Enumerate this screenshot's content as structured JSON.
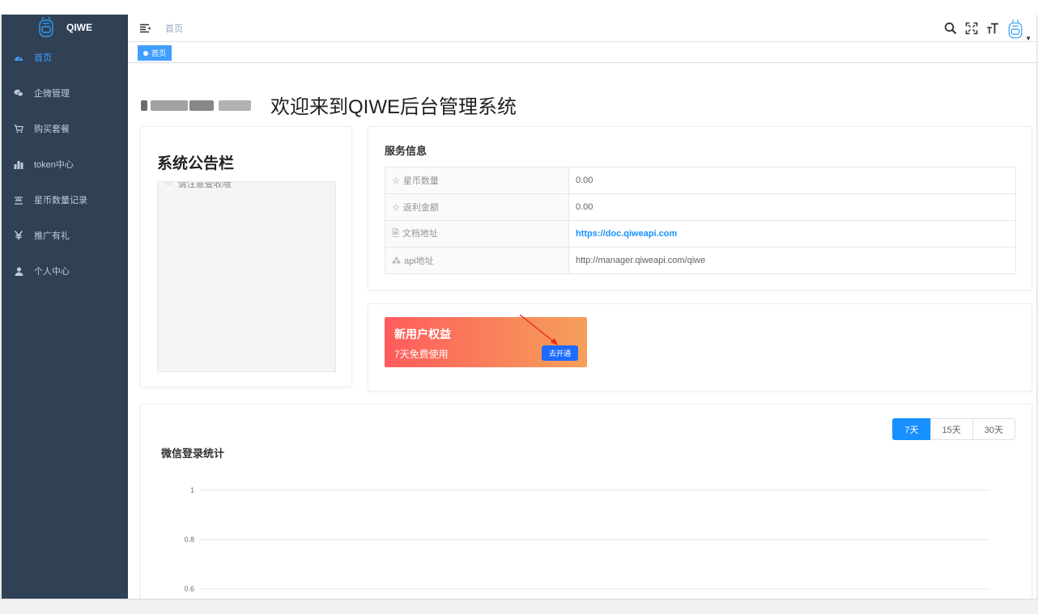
{
  "app": {
    "logo_text": "QIWE"
  },
  "sidebar": {
    "items": [
      {
        "label": "首页",
        "icon": "dashboard-icon",
        "active": true
      },
      {
        "label": "企微管理",
        "icon": "wechat-icon",
        "active": false
      },
      {
        "label": "购买套餐",
        "icon": "cart-icon",
        "active": false
      },
      {
        "label": "token中心",
        "icon": "bar-chart-icon",
        "active": false
      },
      {
        "label": "星币数量记录",
        "icon": "coin-record-icon",
        "active": false
      },
      {
        "label": "推广有礼",
        "icon": "yen-icon",
        "active": false
      },
      {
        "label": "个人中心",
        "icon": "user-icon",
        "active": false
      }
    ]
  },
  "navbar": {
    "breadcrumb": "首页",
    "icons": [
      "search-icon",
      "fullscreen-icon",
      "font-size-icon",
      "avatar-icon",
      "caret-down-icon"
    ]
  },
  "tags": {
    "active_tag": "首页"
  },
  "welcome": {
    "text": "欢迎来到QIWE后台管理系统"
  },
  "notice": {
    "title": "系统公告栏",
    "line": "请注意查收哦"
  },
  "service": {
    "title": "服务信息",
    "rows": [
      {
        "label": "星币数量",
        "value": "0.00",
        "icon": "star-icon"
      },
      {
        "label": "返利金额",
        "value": "0.00",
        "icon": "star-icon"
      },
      {
        "label": "文档地址",
        "value": "https://doc.qiweapi.com",
        "icon": "document-icon"
      },
      {
        "label": "api地址",
        "value": "http://manager.qiweapi.com/qiwe",
        "icon": "api-icon"
      }
    ]
  },
  "promo": {
    "title": "新用户权益",
    "subtitle": "7天免费使用",
    "button": "去开通"
  },
  "chart": {
    "range_options": [
      "7天",
      "15天",
      "30天"
    ],
    "active_range": "7天"
  },
  "chart_data": {
    "type": "line",
    "title": "微信登录统计",
    "y_ticks": [
      "1",
      "0.8",
      "0.6"
    ],
    "ylim": [
      0,
      1
    ],
    "series": []
  },
  "colors": {
    "sidebar_bg": "#304156",
    "accent": "#1890ff",
    "tag_active": "#409eff",
    "promo_start": "#ff5c5c",
    "promo_end": "#f5a05a"
  }
}
